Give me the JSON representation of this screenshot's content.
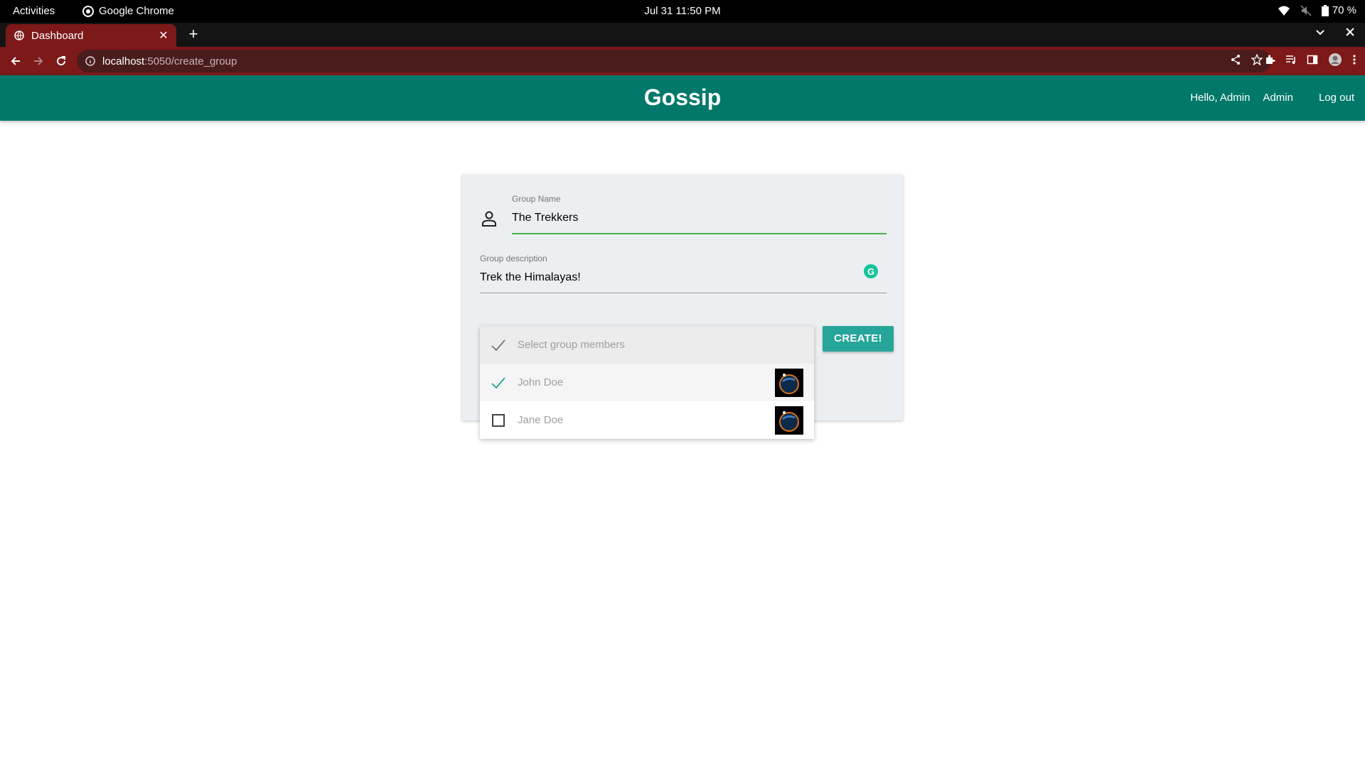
{
  "system_bar": {
    "activities": "Activities",
    "app_name": "Google Chrome",
    "clock": "Jul 31  11:50 PM",
    "battery": "70 %",
    "icons": [
      "wifi-icon",
      "volume-muted-icon",
      "battery-icon"
    ]
  },
  "browser": {
    "tab_title": "Dashboard",
    "url_host": "localhost",
    "url_path": ":5050/create_group",
    "toolbar_icons": [
      "share-icon",
      "star-icon",
      "extensions-icon",
      "media-icon",
      "sidepanel-icon",
      "profile-icon",
      "menu-icon"
    ],
    "accent_color": "#7d1919"
  },
  "app": {
    "brand": "Gossip",
    "greeting": "Hello, Admin",
    "user_link": "Admin",
    "logout": "Log out",
    "primary_color": "#00796b"
  },
  "form": {
    "group_name_label": "Group Name",
    "group_name_value": "The Trekkers",
    "description_label": "Group description",
    "description_value": "Trek the Himalayas!",
    "create_button": "CREATE!",
    "button_color": "#26a69a"
  },
  "members": {
    "placeholder": "Select group members",
    "items": [
      {
        "name": "John Doe",
        "selected": true
      },
      {
        "name": "Jane Doe",
        "selected": false
      }
    ]
  }
}
